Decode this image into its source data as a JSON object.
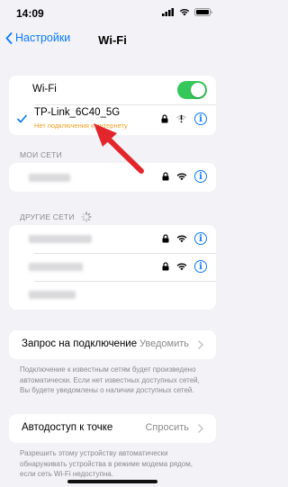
{
  "status_bar": {
    "time": "14:09"
  },
  "nav": {
    "back_label": "Настройки",
    "title": "Wi-Fi"
  },
  "wifi": {
    "label": "Wi-Fi",
    "enabled": true
  },
  "current_network": {
    "name": "TP-Link_6C40_5G",
    "status": "Нет подключения к интернету",
    "status_color": "#f0a020"
  },
  "my_networks": {
    "header": "МОИ СЕТИ"
  },
  "other_networks": {
    "header": "ДРУГИЕ СЕТИ"
  },
  "ask_to_join": {
    "label": "Запрос на подключение",
    "value": "Уведомить",
    "footer": "Подключение к известным сетям будет произведено автоматически. Если нет известных доступных сетей, Вы будете уведомлены о наличии доступных сетей."
  },
  "auto_hotspot": {
    "label": "Автодоступ к точке",
    "value": "Спросить",
    "footer": "Разрешить этому устройству автоматически обнаруживать устройства в режиме модема рядом, если сеть Wi-Fi недоступна."
  },
  "colors": {
    "accent": "#0a7aff",
    "toggle_on": "#34c759",
    "arrow": "#e3262b"
  }
}
